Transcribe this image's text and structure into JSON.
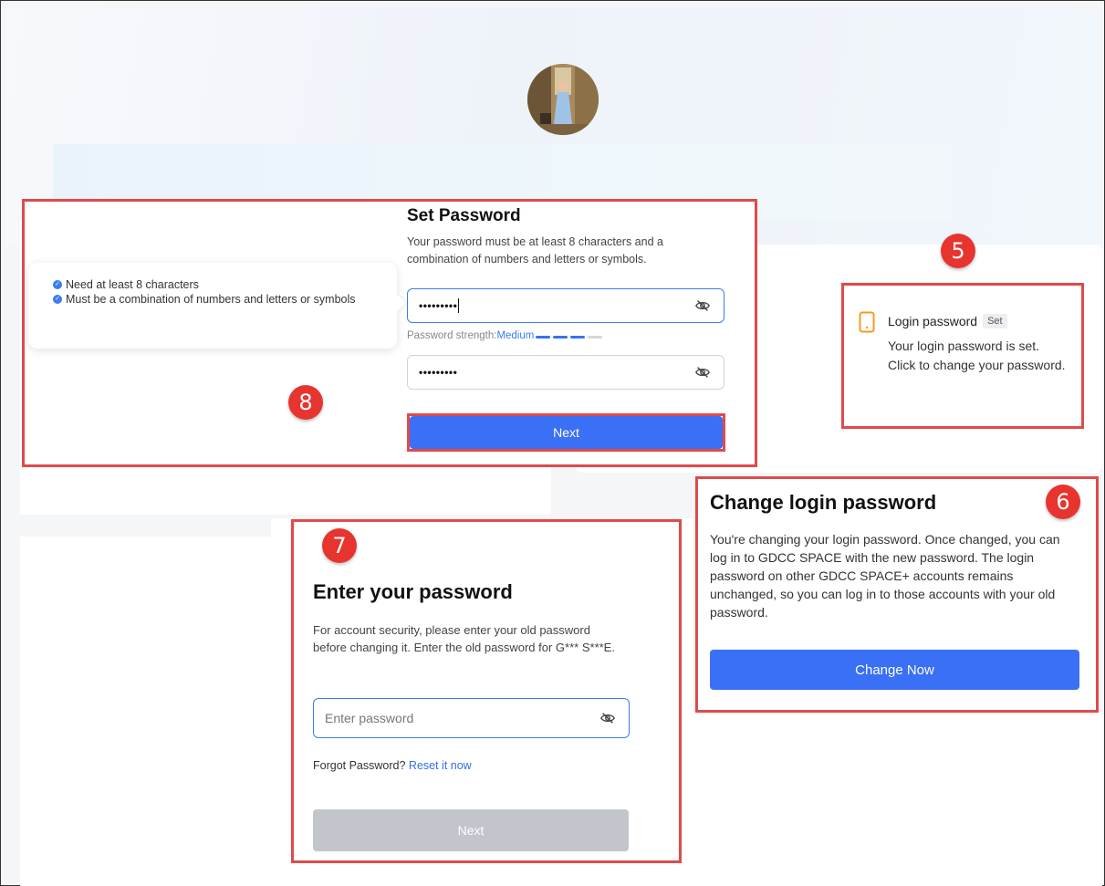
{
  "set_password": {
    "title": "Set Password",
    "description": "Your password must be at least 8 characters and a combination of numbers and letters or symbols.",
    "rules": [
      "Need at least 8 characters",
      "Must be a combination of numbers and letters or symbols"
    ],
    "password_value": "•••••••••",
    "confirm_value": "•••••••••",
    "strength_label": "Password strength:",
    "strength_level": "Medium",
    "strength_segments_filled": 3,
    "strength_segments_total": 4,
    "next_label": "Next",
    "badge": "8"
  },
  "login_password": {
    "title": "Login password",
    "tag": "Set",
    "description": "Your login password is set. Click to change your password.",
    "badge": "5"
  },
  "change_login": {
    "title": "Change login password",
    "description": "You're changing your login password. Once changed, you can log in to GDCC SPACE with the new password. The login password on other GDCC SPACE+ accounts remains unchanged, so you can log in to those accounts with your old password.",
    "button_label": "Change Now",
    "badge": "6"
  },
  "enter_password": {
    "title": "Enter your password",
    "description": "For account security, please enter your old password before changing it. Enter the old password for G*** S***E.",
    "placeholder": "Enter password",
    "forgot_text": "Forgot Password?",
    "reset_link": "Reset it now",
    "next_label": "Next",
    "badge": "7"
  },
  "colors": {
    "primary": "#3a70f5",
    "highlight": "#e04a4a",
    "badge": "#e8342e",
    "icon_orange": "#f59a23",
    "disabled": "#c2c5cb"
  }
}
